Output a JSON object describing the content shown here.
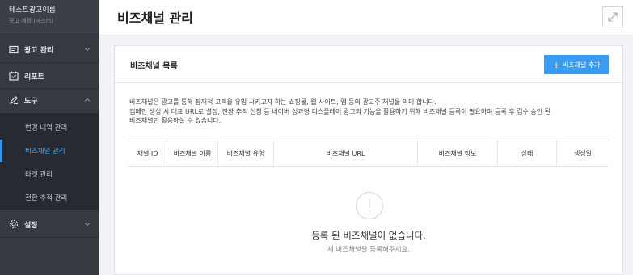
{
  "sidebar": {
    "account_name": "테스트광고이름",
    "account_role": "광고 계정 (마스터)",
    "menu": {
      "ads": "광고 관리",
      "reports": "리포트",
      "tools": "도구",
      "settings": "설정"
    },
    "tools_items": [
      {
        "label": "변경 내역 관리"
      },
      {
        "label": "비즈채널 관리"
      },
      {
        "label": "타겟 관리"
      },
      {
        "label": "전환 추적 관리"
      }
    ],
    "active_item": "비즈채널 관리"
  },
  "header": {
    "title": "비즈채널 관리",
    "expand_icon": "expand-icon"
  },
  "card": {
    "title": "비즈채널 목록",
    "add_button": "+ 비즈채널 추가",
    "add_button_text": "비즈채널 추가",
    "description_line1": "비즈채널은 광고를 통해 잠재적 고객을 유입 시키고자 하는 쇼핑몰, 웹 사이트, 앱 등의 광고주 채널을 의미 합니다.",
    "description_line2": "캠페인 생성 시 대표 URL로 설정, 전환 추적 신청 등 네이버 성과형 디스플레이 광고의 기능을 활용하기 위해 비즈채널 등록이 필요하며 등록 후 검수 승인 된",
    "description_line3": "비즈채널만 활용하실 수 있습니다."
  },
  "table": {
    "columns": [
      "채널 ID",
      "비즈채널 이름",
      "비즈채널 유형",
      "비즈채널 URL",
      "비즈채널 정보",
      "상태",
      "생성일"
    ]
  },
  "empty_state": {
    "title": "등록 된 비즈채널이 없습니다.",
    "subtitle": "새 비즈채널을 등록해주세요."
  },
  "colors": {
    "sidebar_bg": "#353a41",
    "submenu_bg": "#272b31",
    "accent": "#3a9bf0",
    "active_text": "#4aa3f2"
  }
}
